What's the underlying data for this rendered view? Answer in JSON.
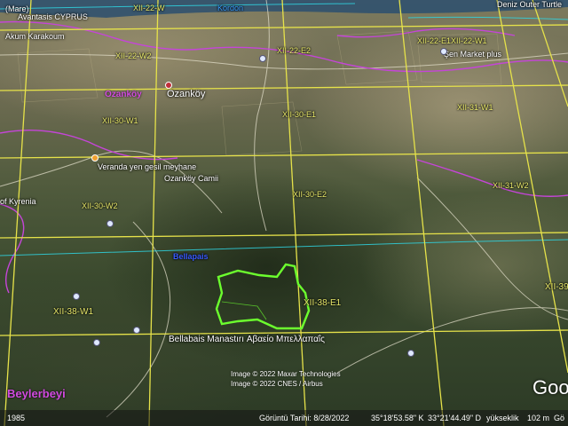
{
  "top_labels": {
    "coast_left": "(Mare)",
    "cyprus_label": "Avantasis CYPRUS",
    "top_center": "XII-22-W",
    "top_center_blue": "Kordon",
    "top_right": "Deniz Outer Turtle"
  },
  "places": {
    "karakoum": "Akum Karakoum",
    "ozankoy_purple": "Ozanköy",
    "ozankoy": "Ozanköy",
    "veranda": "Veranda yen gesil meyhane",
    "ozankoy_camii": "Ozanköy Camii",
    "kyrenia": "of Kyrenia",
    "bellabais": "Bellabais Manastırı Αβαείο Μπελλαπαΐς",
    "beylerbeyi": "Beylerbeyi",
    "bellapais_blue": "Bellapais",
    "market": "Şen Market plus"
  },
  "grid_labels": {
    "g1": "XII-22-W2",
    "g2": "XII-22-E2",
    "g3": "XII-22-E1XII-22-W1",
    "g4": "XII-30-W1",
    "g5": "XII-30-E1",
    "g6": "XII-31-W1",
    "g7": "XII-30-E2",
    "g8": "XII-31-W2",
    "g9": "XII-30-W2",
    "g10": "XII-38-W1",
    "g11": "XII-38-E1",
    "g12": "XII-39"
  },
  "credits": {
    "line1": "Image © 2022 Maxar Technologies",
    "line2": "Image © 2022 CNES / Airbus"
  },
  "logo": "Goo",
  "status": {
    "year": "1985",
    "date": "Görüntü Tarihi: 8/28/2022",
    "lat": "35°18'53.58\" K",
    "lon": "33°21'44.49\" D",
    "elev_label": "yükseklik",
    "elev": "102 m",
    "eye": "Gö"
  },
  "colors": {
    "grid": "#e6e24a",
    "boundary": "#6cff2e",
    "purple_line": "#c545d8",
    "cyan_line": "#2fd3e0"
  }
}
